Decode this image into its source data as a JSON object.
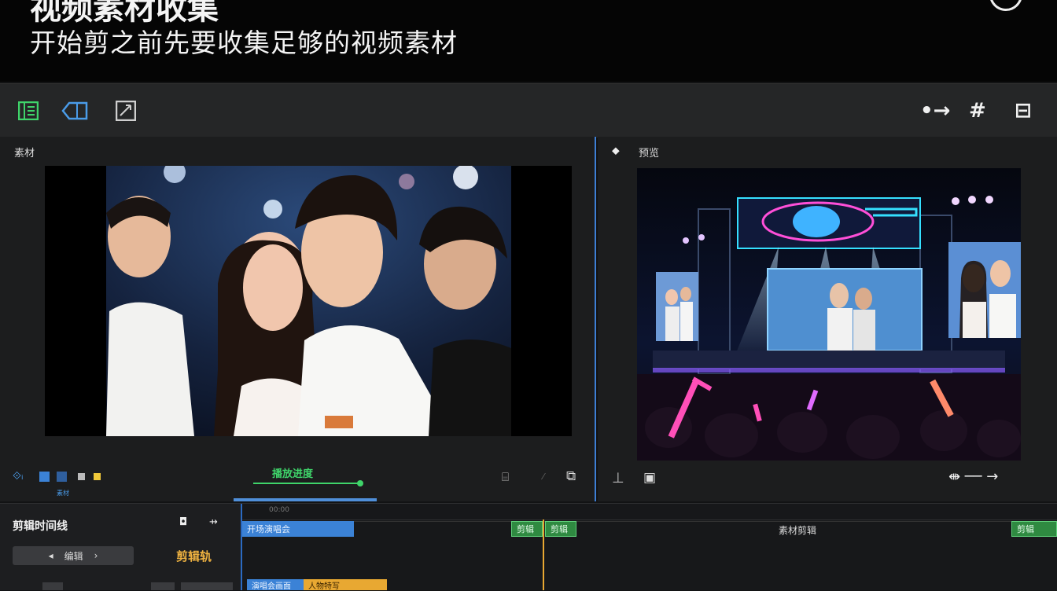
{
  "banner": {
    "title": "视频素材收集",
    "subtitle": "开始剪之前先要收集足够的视频素材"
  },
  "toolbar": {
    "left_icons": [
      "media-library-icon",
      "import-icon",
      "effects-icon"
    ],
    "right_icons": [
      "transition-icon",
      "grid-icon",
      "layout-icon"
    ],
    "transition_glyph": "•→",
    "grid_glyph": "#",
    "layout_glyph": "⊟"
  },
  "left_panel": {
    "title": "素材",
    "progress_label": "播放进度",
    "small_label": "素材"
  },
  "right_panel": {
    "title": "预览",
    "playback_glyph": "⇼ ── →"
  },
  "timeline": {
    "title": "剪辑时间线",
    "nav_label": "编辑",
    "nav_prev": "◂",
    "nav_next": "›",
    "orange_label": "剪辑轨",
    "ruler_label": "00:00",
    "clips": [
      {
        "label": "开场演唱会",
        "color": "#3b82d6"
      },
      {
        "label": "剪辑",
        "color": "#3aa44f"
      },
      {
        "label": "剪辑",
        "color": "#3aa44f"
      },
      {
        "label": "演唱会画面",
        "color": "#3b82d6"
      },
      {
        "label": "人物特写",
        "color": "#e8a832"
      },
      {
        "label": "剪辑",
        "color": "#3aa44f"
      }
    ],
    "center_label": "素材剪辑"
  },
  "colors": {
    "accent_blue": "#3d7fd6",
    "accent_green": "#3fd46a",
    "accent_orange": "#f0b341"
  }
}
